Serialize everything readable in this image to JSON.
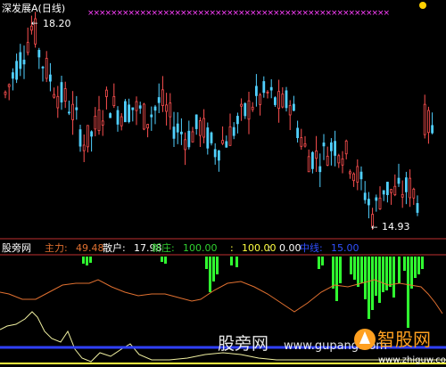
{
  "window_title": "深发展A(日线)",
  "panel_title": "股旁网",
  "price_high_label": "18.20",
  "price_low_label": "14.93",
  "indicators": [
    {
      "label": "主力:",
      "value": "49.48",
      "color": "#e07030"
    },
    {
      "label": "散户:",
      "value": "17.98",
      "color": "#ffffff"
    },
    {
      "label": "新庄:",
      "value": "100.00",
      "color": "#30d030"
    },
    {
      "label": ":",
      "value": "100.00",
      "color": "#ffff40"
    },
    {
      "label": ":",
      "value": "0.00",
      "color": "#ffffff"
    },
    {
      "label": "中线:",
      "value": "15.00",
      "color": "#3050ff"
    }
  ],
  "watermark_text": "股旁网",
  "watermark_url": "www.gupang.com",
  "logo_text": "智股网",
  "logo_url": "www.zhiguw.com",
  "colors": {
    "up": "#ff5050",
    "down": "#50d0ff",
    "marker": "#ff40ff",
    "main_line": "#e07030",
    "retail_line": "#ffffff",
    "new_bars": "#30ff30",
    "mid_line": "#3040ff"
  },
  "chart_data": {
    "type": "candlestick",
    "high": 18.2,
    "low": 14.93,
    "indicators": {
      "main": 49.48,
      "retail": 17.98,
      "new_dealer": 100.0,
      "mid_line": 15.0
    }
  }
}
